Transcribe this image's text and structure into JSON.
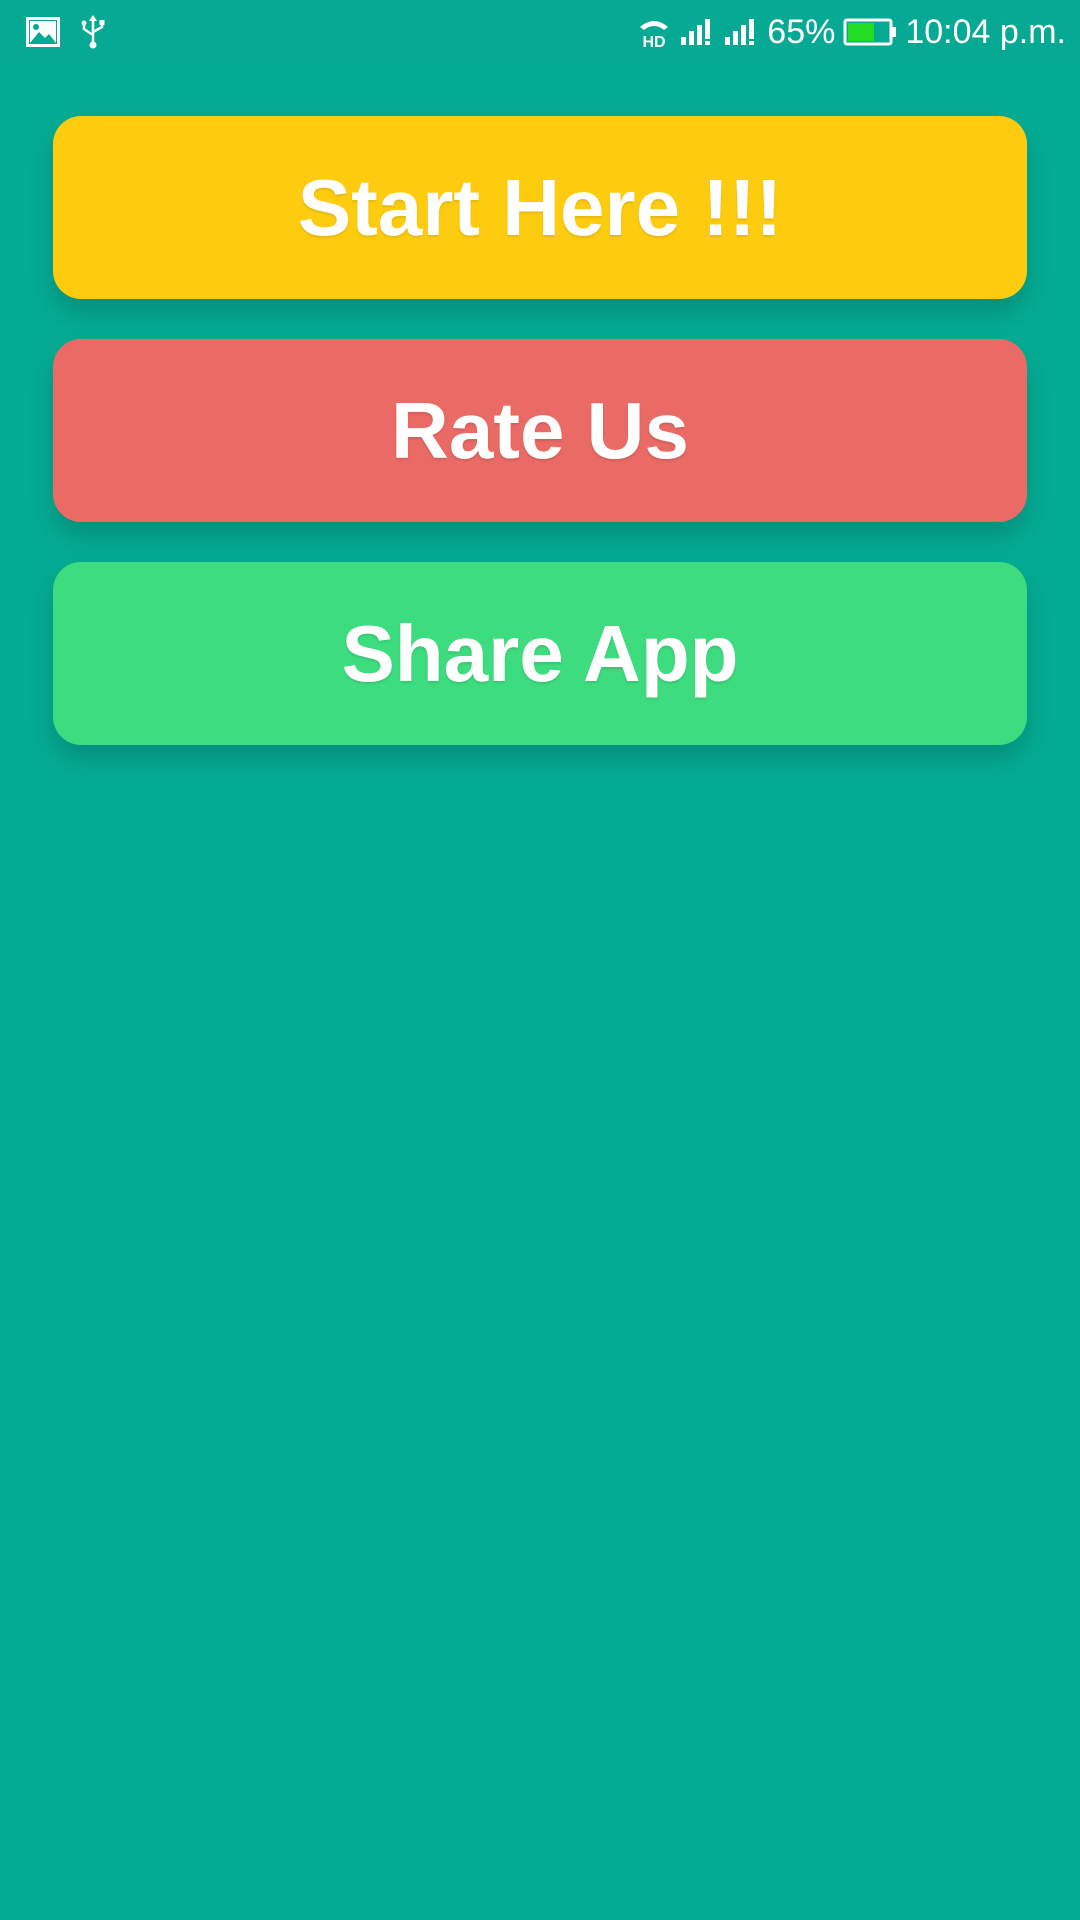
{
  "status_bar": {
    "battery_percent": "65%",
    "time": "10:04 p.m.",
    "battery_level": 0.65,
    "icons_left": [
      "image-icon",
      "usb-icon"
    ],
    "icons_right": [
      "hd-call-icon",
      "signal-icon",
      "signal-icon",
      "battery-icon"
    ]
  },
  "buttons": {
    "start_label": "Start Here !!!",
    "rate_label": "Rate Us",
    "share_label": "Share App"
  },
  "colors": {
    "background": "#05AC94",
    "start": "#FECC0F",
    "rate": "#EA6A65",
    "share": "#3DDC7E",
    "battery_fill": "#22DD22"
  }
}
